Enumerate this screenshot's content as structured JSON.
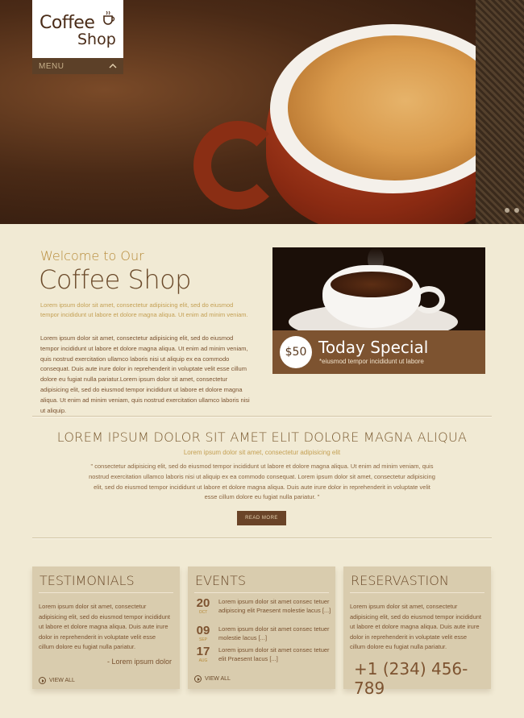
{
  "logo": {
    "line1": "Coffee",
    "line2": "Shop"
  },
  "menu": {
    "label": "MENU"
  },
  "welcome": {
    "subtitle": "Welcome to Our",
    "title": "Coffee Shop",
    "gold_text": "Lorem ipsum dolor sit amet, consectetur adipisicing elit, sed do eiusmod tempor incididunt ut labore et dolore magna aliqua. Ut enim ad minim veniam.",
    "body_text": "Lorem ipsum dolor sit amet, consectetur adipisicing elit, sed do eiusmod tempor incididunt ut labore et dolore magna aliqua. Ut enim ad minim veniam, quis nostrud exercitation ullamco laboris nisi ut aliquip ex ea commodo consequat. Duis aute irure dolor in reprehenderit in voluptate velit esse cillum dolore eu fugiat nulla pariatur.Lorem ipsum dolor sit amet, consectetur adipisicing elit, sed do eiusmod tempor incididunt ut labore et dolore magna aliqua. Ut enim ad minim veniam, quis nostrud exercitation ullamco laboris nisi ut aliquip."
  },
  "special": {
    "price": "$50",
    "title": "Today Special",
    "description": "*eiusmod tempor incididunt ut labore"
  },
  "lorem": {
    "title": "LOREM IPSUM DOLOR SIT AMET ELIT DOLORE MAGNA ALIQUA",
    "subtitle": "Lorem ipsum dolor sit amet, consectetur adipisicing elit",
    "quote": "\" consectetur adipisicing elit, sed do eiusmod tempor incididunt ut labore et dolore magna aliqua. Ut enim ad minim veniam, quis nostrud exercitation ullamco laboris nisi ut aliquip ex ea commodo consequat. Lorem ipsum dolor sit amet, consectetur adipisicing elit, sed do eiusmod tempor incididunt ut labore et dolore magna aliqua. Duis aute irure dolor in reprehenderit in voluptate velit esse cillum dolore eu fugiat nulla pariatur. \"",
    "read_more": "READ MORE"
  },
  "testimonials": {
    "title": "TESTIMONIALS",
    "text": "Lorem ipsum dolor sit amet, consectetur adipisicing elit, sed do eiusmod tempor incididunt ut labore et dolore magna aliqua. Duis aute irure dolor in reprehenderit in voluptate velit esse cillum dolore eu fugiat nulla pariatur.",
    "signature": "- Lorem ipsum dolor",
    "view_all": "VIEW ALL"
  },
  "events": {
    "title": "EVENTS",
    "items": [
      {
        "day": "20",
        "month": "OCT",
        "text": "Lorem ipsum dolor sit amet consec tetuer adipiscing elit Praesent molestie lacus [...]"
      },
      {
        "day": "09",
        "month": "SEP",
        "text": "Lorem ipsum dolor sit amet consec tetuer molestie lacus [...]"
      },
      {
        "day": "17",
        "month": "AUG",
        "text": "Lorem ipsum dolor sit amet consec tetuer elit Praesent lacus [...]"
      }
    ],
    "view_all": "VIEW ALL"
  },
  "reservation": {
    "title": "RESERVASTION",
    "text": "Lorem ipsum dolor sit amet, consectetur adipisicing elit, sed do eiusmod tempor incididunt ut labore et dolore magna aliqua. Duis aute irure dolor in reprehenderit in voluptate velit esse cillum dolore eu fugiat nulla pariatur.",
    "phone": "+1 (234) 456-789"
  }
}
